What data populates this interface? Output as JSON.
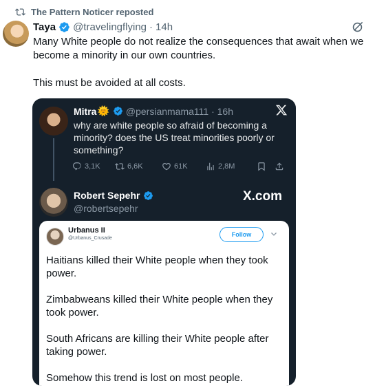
{
  "repost": {
    "text": "The Pattern Noticer reposted"
  },
  "tweet": {
    "author_name": "Taya",
    "author_handle": "@travelingflying",
    "separator": "·",
    "time": "14h",
    "lines": [
      "Many White people do not realize the consequences that await when we become a minority in our own countries.",
      "This must be avoided at all costs."
    ]
  },
  "media": {
    "quoted": {
      "name": "Mitra",
      "name_emoji": "🌞",
      "handle_time": "@persianmama111 · 16h",
      "text": "why are white people so afraid of becoming a minority? does the US treat minorities poorly or something?",
      "actions": {
        "replies": "3,1K",
        "reposts": "6,6K",
        "likes": "61K",
        "views": "2,8M"
      }
    },
    "reply": {
      "name": "Robert Sepehr",
      "handle": "@robertsepehr",
      "brand": "X.com"
    },
    "inner": {
      "name": "Urbanus II",
      "handle": "@Urbanus_Crusade",
      "follow_label": "Follow",
      "paragraphs": [
        "Haitians killed their White people when they took power.",
        "Zimbabweans killed their White people when they took power.",
        "South Africans are killing their White people after taking power.",
        "Somehow this trend is lost on most people."
      ]
    }
  },
  "colors": {
    "accent": "#1d9bf0",
    "media_bg": "#15202b",
    "secondary_text": "#536471"
  }
}
